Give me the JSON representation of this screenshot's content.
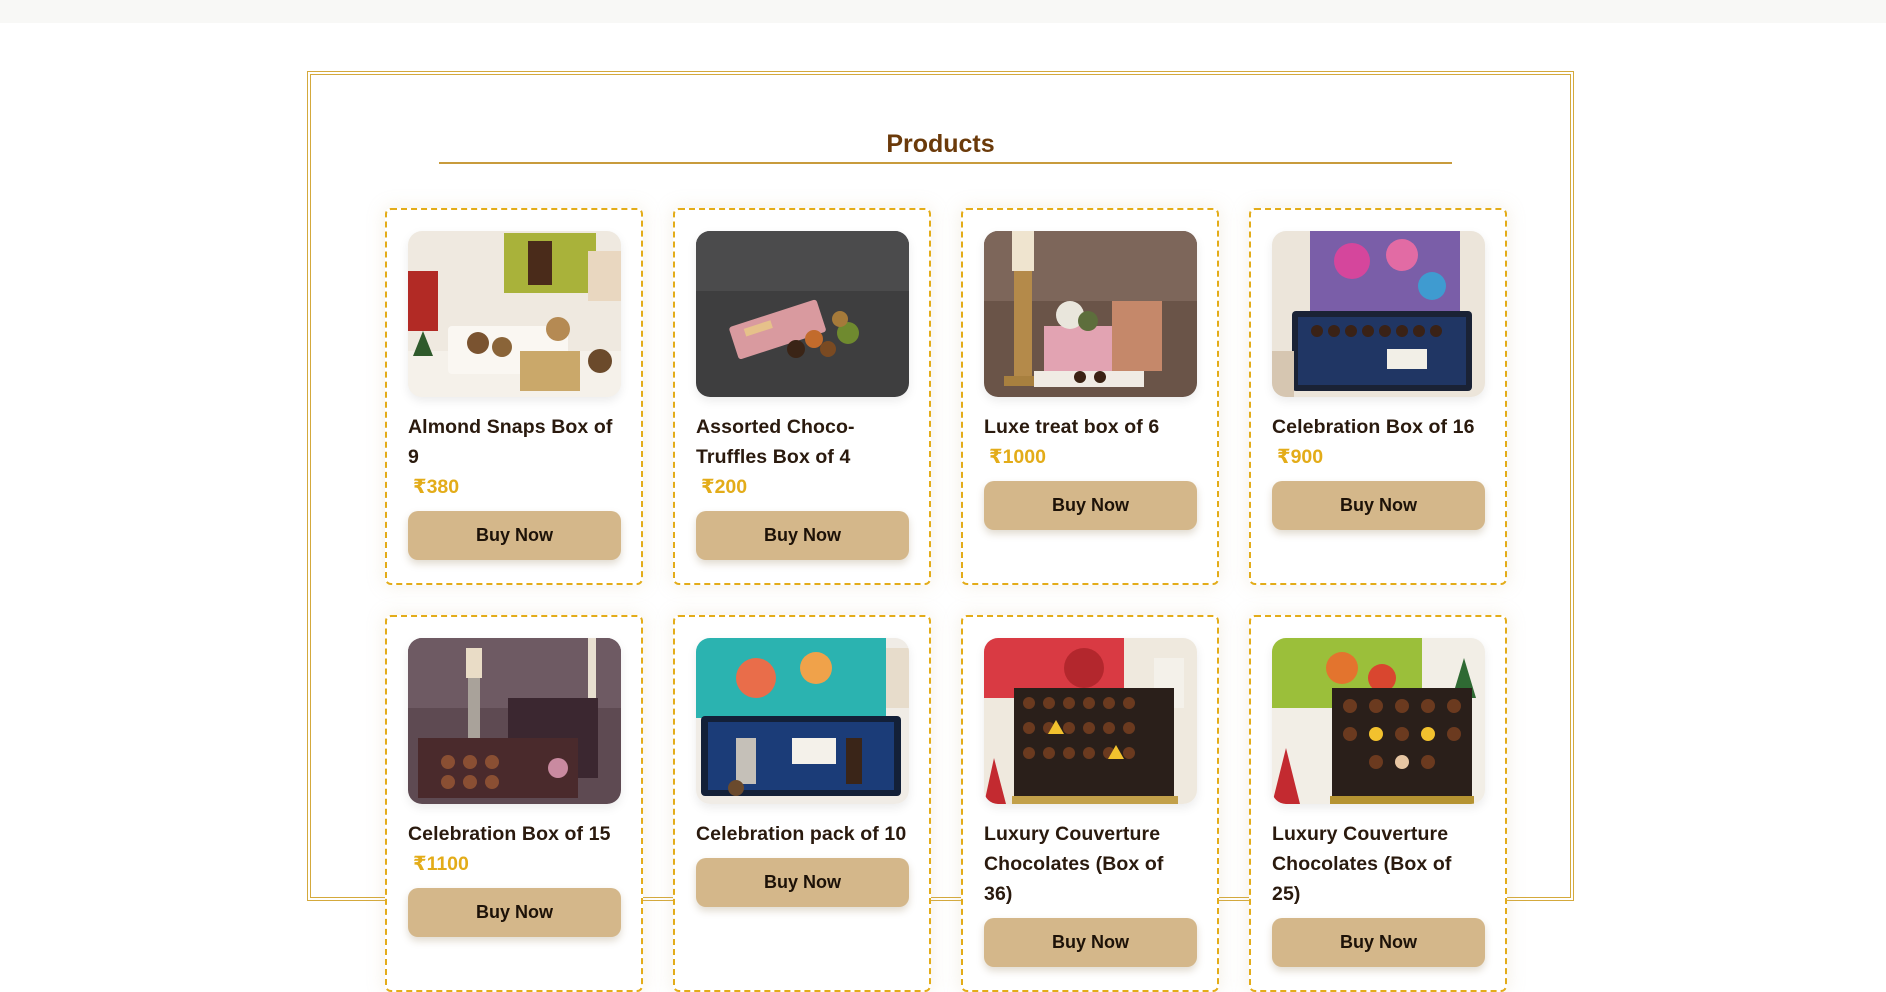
{
  "section": {
    "title": "Products"
  },
  "currency_symbol": "₹",
  "products": [
    {
      "name": "Almond Snaps Box of 9",
      "price": "₹380",
      "button": "Buy Now",
      "image": "almond-snaps-box"
    },
    {
      "name": "Assorted Choco-Truffles Box of 4",
      "price": "₹200",
      "button": "Buy Now",
      "image": "choco-truffles-box"
    },
    {
      "name": "Luxe treat box of 6",
      "price": "₹1000",
      "button": "Buy Now",
      "image": "luxe-treat-box"
    },
    {
      "name": "Celebration Box of 16",
      "price": "₹900",
      "button": "Buy Now",
      "image": "celebration-box-16"
    },
    {
      "name": "Celebration Box of 15",
      "price": "₹1100",
      "button": "Buy Now",
      "image": "celebration-box-15"
    },
    {
      "name": "Celebration pack of 10",
      "price": "",
      "button": "Buy Now",
      "image": "celebration-pack-10"
    },
    {
      "name": "Luxury Couverture Chocolates (Box of 36)",
      "price": "",
      "button": "Buy Now",
      "image": "luxury-couverture-36"
    },
    {
      "name": "Luxury Couverture Chocolates (Box of 25)",
      "price": "",
      "button": "Buy Now",
      "image": "luxury-couverture-25"
    }
  ],
  "colors": {
    "accent": "#e3ac19",
    "title": "#6b3a0a",
    "button": "#d4b78a",
    "frame": "#d4a93c"
  }
}
